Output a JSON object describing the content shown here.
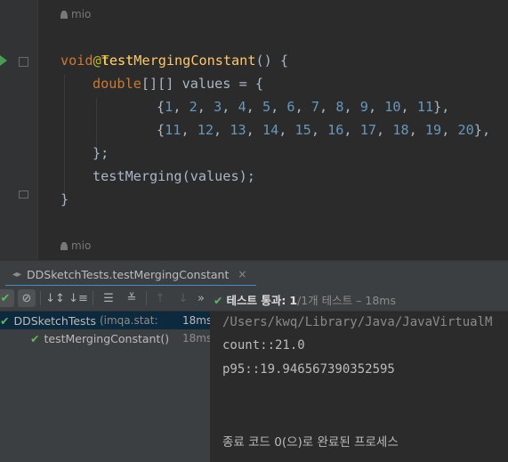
{
  "editor": {
    "author_hint_top": "mio",
    "annotation": "@Test",
    "method_kw": "void",
    "method_name": "testMergingConstant",
    "method_tail": "() {",
    "decl_type": "double",
    "decl_rest": "[][] values = {",
    "row1_open": "{",
    "row1_nums": [
      "1",
      "2",
      "3",
      "4",
      "5",
      "6",
      "7",
      "8",
      "9",
      "10",
      "11"
    ],
    "row1_close": "},",
    "row2_open": "{",
    "row2_nums": [
      "11",
      "12",
      "13",
      "14",
      "15",
      "16",
      "17",
      "18",
      "19",
      "20"
    ],
    "row2_close": "},",
    "close_arr": "};",
    "call_name": "testMerging",
    "call_args": "(values);",
    "close_brace": "}",
    "author_hint_bottom": "mio"
  },
  "run_tab": {
    "title": "DDSketchTests.testMergingConstant",
    "close": "×"
  },
  "toolbar": {
    "status_label": "테스트 통과:",
    "status_count": "1",
    "status_total": "/1개 테스트",
    "status_time": "– 18ms",
    "expand_more": "»"
  },
  "tree": {
    "root_label": "DDSketchTests",
    "root_pkg": "(imqa.stat:",
    "root_time": "18ms",
    "child_label": "testMergingConstant()",
    "child_time": "18ms"
  },
  "console": {
    "path": "/Users/kwq/Library/Java/JavaVirtualM",
    "line1": "count::21.0",
    "line2": "p95::19.946567390352595",
    "exit": "종료 코드 0(으)로 완료된 프로세스"
  },
  "colors": {
    "keyword": "#cc7832",
    "function": "#ffc66d",
    "number": "#6897bb",
    "annotation": "#bbb529",
    "pass_green": "#5fb85f"
  }
}
